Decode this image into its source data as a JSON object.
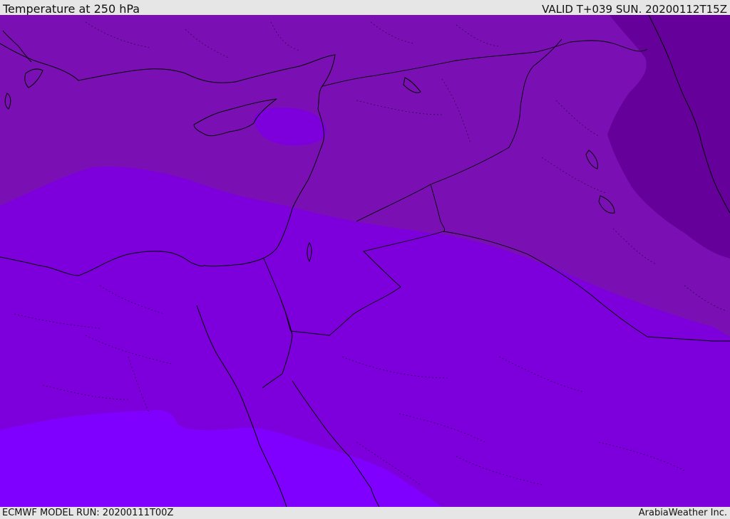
{
  "header": {
    "title": "Temperature at 250 hPa",
    "valid": "VALID T+039 SUN. 20200112T15Z"
  },
  "footer": {
    "model_run": "ECMWF MODEL RUN: 20200111T00Z",
    "provider": "ArabiaWeather Inc."
  },
  "map": {
    "colors": {
      "band_coldest": "#65009a",
      "band_cold": "#7a10b4",
      "band_mid": "#7d00dc",
      "band_warm": "#7f00ff",
      "coastline": "#000000",
      "borders": "#000000"
    }
  }
}
